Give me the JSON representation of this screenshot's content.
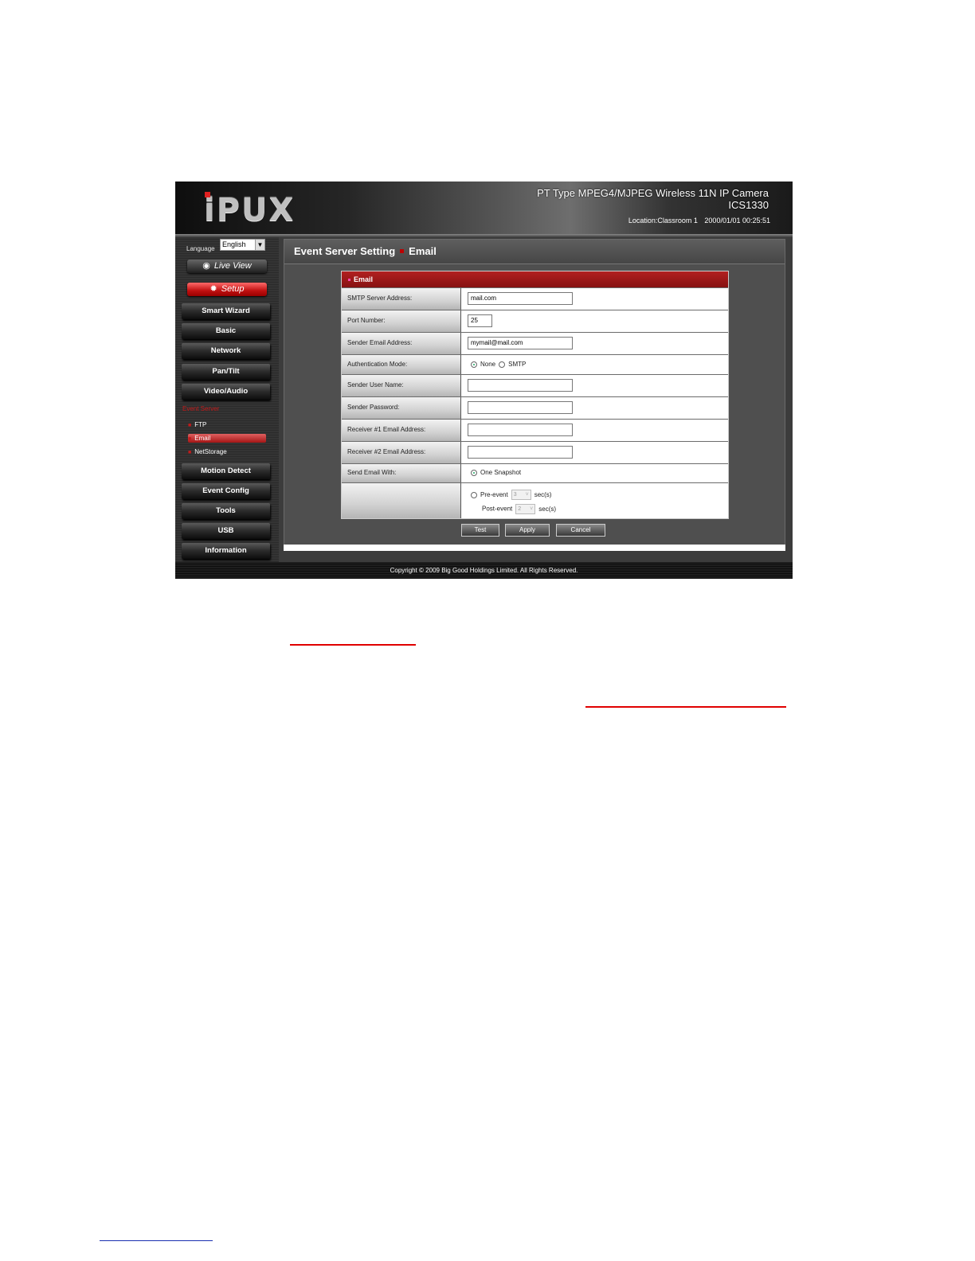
{
  "app": {
    "logo_text": "iPUX",
    "product_title": "PT Type MPEG4/MJPEG Wireless 11N IP Camera",
    "model": "ICS1330",
    "location_label": "Location:Classroom 1",
    "datetime": "2000/01/01 00:25:51"
  },
  "sidebar": {
    "language_label": "Language",
    "language_value": "English",
    "live_view": "Live View",
    "setup": "Setup",
    "nav": [
      {
        "label": "Smart Wizard"
      },
      {
        "label": "Basic"
      },
      {
        "label": "Network"
      },
      {
        "label": "Pan/Tilt"
      },
      {
        "label": "Video/Audio"
      }
    ],
    "sub_title": "Event Server",
    "sub_items": [
      {
        "label": "FTP"
      },
      {
        "label": "Email"
      },
      {
        "label": "NetStorage"
      }
    ],
    "nav2": [
      {
        "label": "Motion Detect"
      },
      {
        "label": "Event Config"
      },
      {
        "label": "Tools"
      },
      {
        "label": "USB"
      },
      {
        "label": "Information"
      }
    ]
  },
  "main": {
    "title": "Event Server Setting",
    "subtitle": "Email",
    "form_header": "Email",
    "rows": {
      "smtp_label": "SMTP Server Address:",
      "smtp_value": "mail.com",
      "port_label": "Port Number:",
      "port_value": "25",
      "sender_label": "Sender Email Address:",
      "sender_value": "mymail@mail.com",
      "auth_label": "Authentication Mode:",
      "auth_none": "None",
      "auth_smtp": "SMTP",
      "user_label": "Sender User Name:",
      "pass_label": "Sender Password:",
      "recv1_label": "Receiver #1 Email Address:",
      "recv2_label": "Receiver #2 Email Address:",
      "send_with_label": "Send Email With:",
      "one_snapshot": "One Snapshot",
      "pre_event": "Pre-event",
      "pre_value": "3",
      "post_event": "Post-event",
      "post_value": "2",
      "secs": "sec(s)"
    },
    "buttons": {
      "test": "Test",
      "apply": "Apply",
      "cancel": "Cancel"
    }
  },
  "footer": {
    "copyright": "Copyright © 2009 Big Good Holdings Limited. All Rights Reserved."
  },
  "colors": {
    "accent_red": "#b22020",
    "annotation_red": "#e00000"
  }
}
